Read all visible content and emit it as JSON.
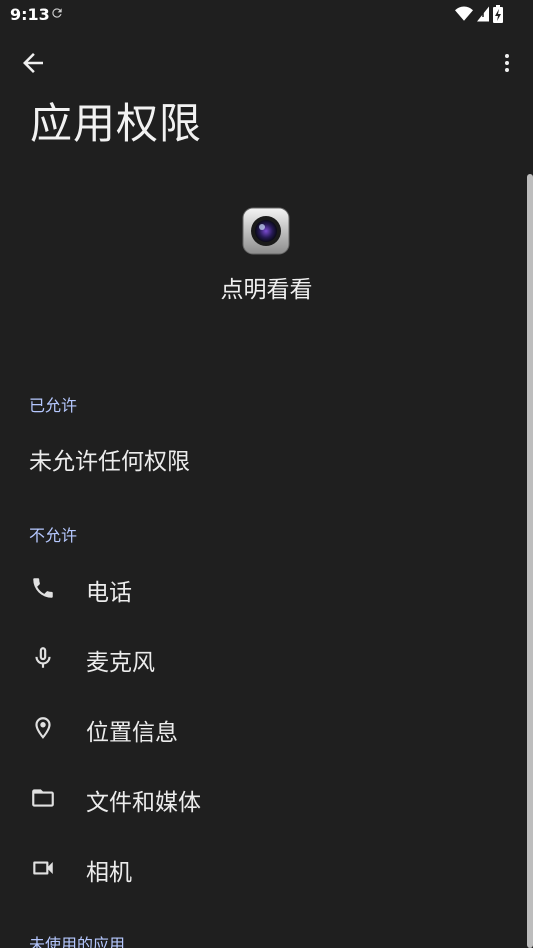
{
  "status": {
    "time": "9:13"
  },
  "header": {
    "title": "应用权限"
  },
  "app": {
    "name": "点明看看",
    "icon": "camera-app-icon"
  },
  "allowed": {
    "header": "已允许",
    "empty_text": "未允许任何权限"
  },
  "denied": {
    "header": "不允许",
    "items": [
      {
        "label": "电话",
        "icon": "phone-icon"
      },
      {
        "label": "麦克风",
        "icon": "microphone-icon"
      },
      {
        "label": "位置信息",
        "icon": "location-icon"
      },
      {
        "label": "文件和媒体",
        "icon": "folder-icon"
      },
      {
        "label": "相机",
        "icon": "camera-icon"
      }
    ]
  },
  "unused": {
    "header": "未使用的应用"
  },
  "colors": {
    "background": "#1f1f1f",
    "accent": "#b6c8ff",
    "text": "#ececec"
  }
}
